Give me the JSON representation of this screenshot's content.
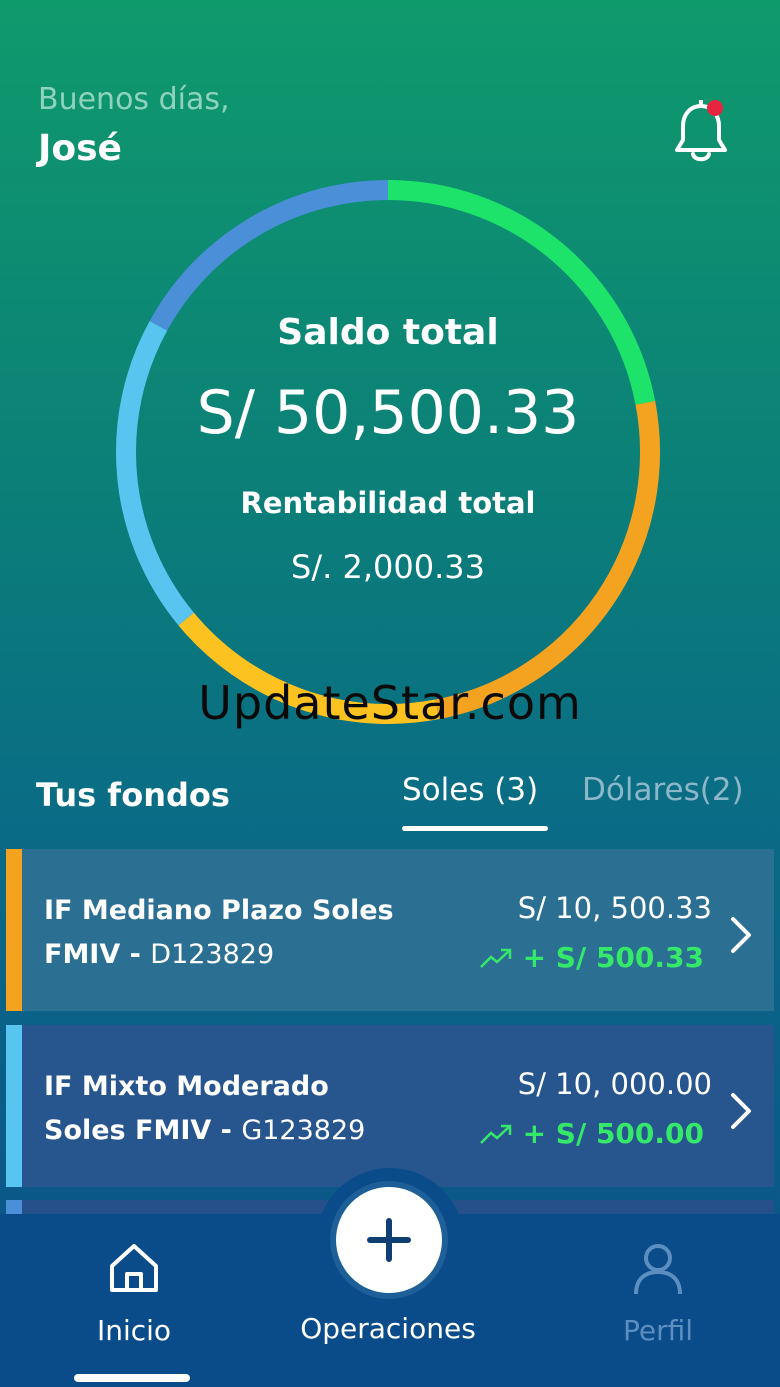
{
  "header": {
    "greeting": "Buenos días,",
    "user_name": "José",
    "notification_icon": "bell-icon",
    "has_unread": true
  },
  "summary": {
    "saldo_label": "Saldo total",
    "saldo_value": "S/ 50,500.33",
    "rent_label": "Rentabilidad total",
    "rent_value": "S/. 2,000.33"
  },
  "ring_segments": [
    {
      "color": "#1ee36a",
      "fraction": 0.22
    },
    {
      "color": "#f4a320",
      "fraction": 0.25
    },
    {
      "color": "#fcc21f",
      "fraction": 0.17
    },
    {
      "color": "#58c5f0",
      "fraction": 0.19
    },
    {
      "color": "#4b8fd9",
      "fraction": 0.17
    }
  ],
  "watermark": "UpdateStar.com",
  "funds": {
    "title": "Tus fondos",
    "tabs": [
      {
        "label": "Soles (3)",
        "active": true
      },
      {
        "label": "Dólares(2)",
        "active": false
      }
    ],
    "items": [
      {
        "name": "IF Mediano Plazo Soles FMIV -",
        "code": "D123829",
        "amount": "S/ 10, 500.33",
        "gain": "+ S/ 500.33",
        "accent": "#f4a320"
      },
      {
        "name": "IF Mixto Moderado Soles FMIV -",
        "code": "G123829",
        "amount": "S/ 10, 000.00",
        "gain": "+ S/ 500.00",
        "accent": "#58c5f0"
      }
    ]
  },
  "nav": {
    "inicio": "Inicio",
    "operaciones": "Operaciones",
    "perfil": "Perfil"
  },
  "colors": {
    "gain": "#35e86a",
    "nav_bg": "#0a4b8a",
    "fab_icon": "#0d3f73"
  }
}
